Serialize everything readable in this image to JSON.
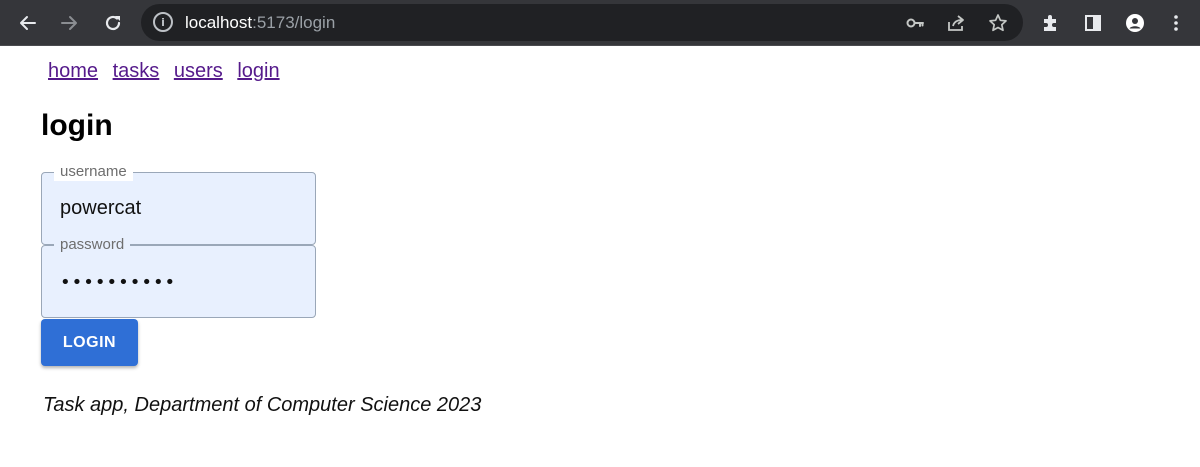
{
  "browser": {
    "url_host": "localhost",
    "url_path": ":5173/login",
    "icons": [
      "back-icon",
      "forward-icon",
      "reload-icon",
      "info-icon",
      "key-icon",
      "share-icon",
      "star-icon",
      "extensions-icon",
      "side-panel-icon",
      "profile-icon",
      "menu-icon"
    ],
    "info_glyph": "i"
  },
  "nav": {
    "links": [
      "home",
      "tasks",
      "users",
      "login"
    ]
  },
  "page": {
    "title": "login"
  },
  "form": {
    "username_label": "username",
    "username_value": "powercat",
    "password_label": "password",
    "password_value": "••••••••••",
    "submit_label": "LOGIN"
  },
  "footer": {
    "text": "Task app, Department of Computer Science 2023"
  },
  "colors": {
    "toolbar": "#35363a",
    "omnibox": "#202124",
    "field_bg": "#e8f0fe",
    "button": "#2f6fd6",
    "visited_link": "#551a8b"
  }
}
